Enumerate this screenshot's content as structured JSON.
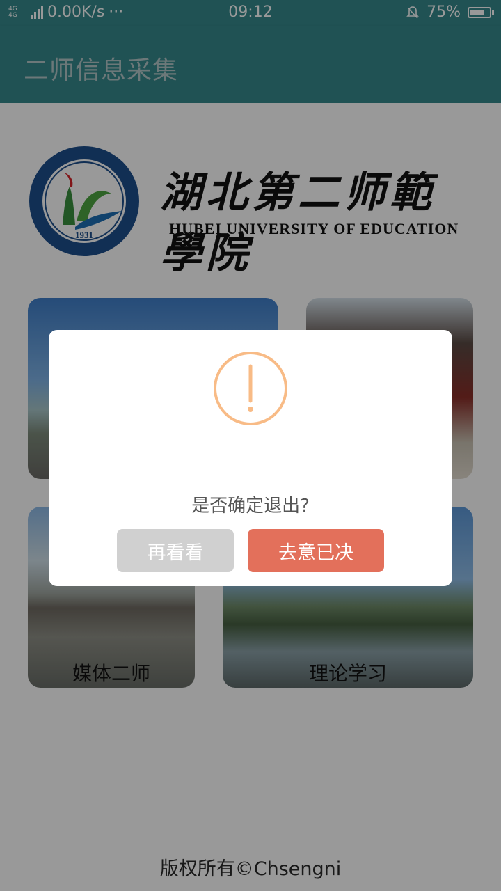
{
  "status_bar": {
    "network_type": "4G 4G",
    "speed": "0.00K/s",
    "more": "···",
    "time": "09:12",
    "battery": "75%",
    "battery_level": 0.75
  },
  "app_bar": {
    "title": "二师信息采集"
  },
  "logo": {
    "seal_year": "1931",
    "seal_ring_text": "HUBEI UNIVERSITY OF EDUCATION",
    "name_cn": "湖北第二师範學院",
    "name_en": "HUBEI UNIVERSITY OF EDUCATION"
  },
  "tiles": [
    {
      "label": ""
    },
    {
      "label": ""
    },
    {
      "label": "媒体二师"
    },
    {
      "label": "理论学习"
    }
  ],
  "footer": {
    "copyright": "版权所有©Chsengni"
  },
  "dialog": {
    "icon": "exclamation-circle-icon",
    "message": "是否确定退出?",
    "cancel_label": "再看看",
    "confirm_label": "去意已决",
    "colors": {
      "icon": "#f8bb86",
      "confirm": "#e3705b",
      "cancel": "#d0d0d0"
    }
  },
  "theme": {
    "primary": "#36898c"
  }
}
